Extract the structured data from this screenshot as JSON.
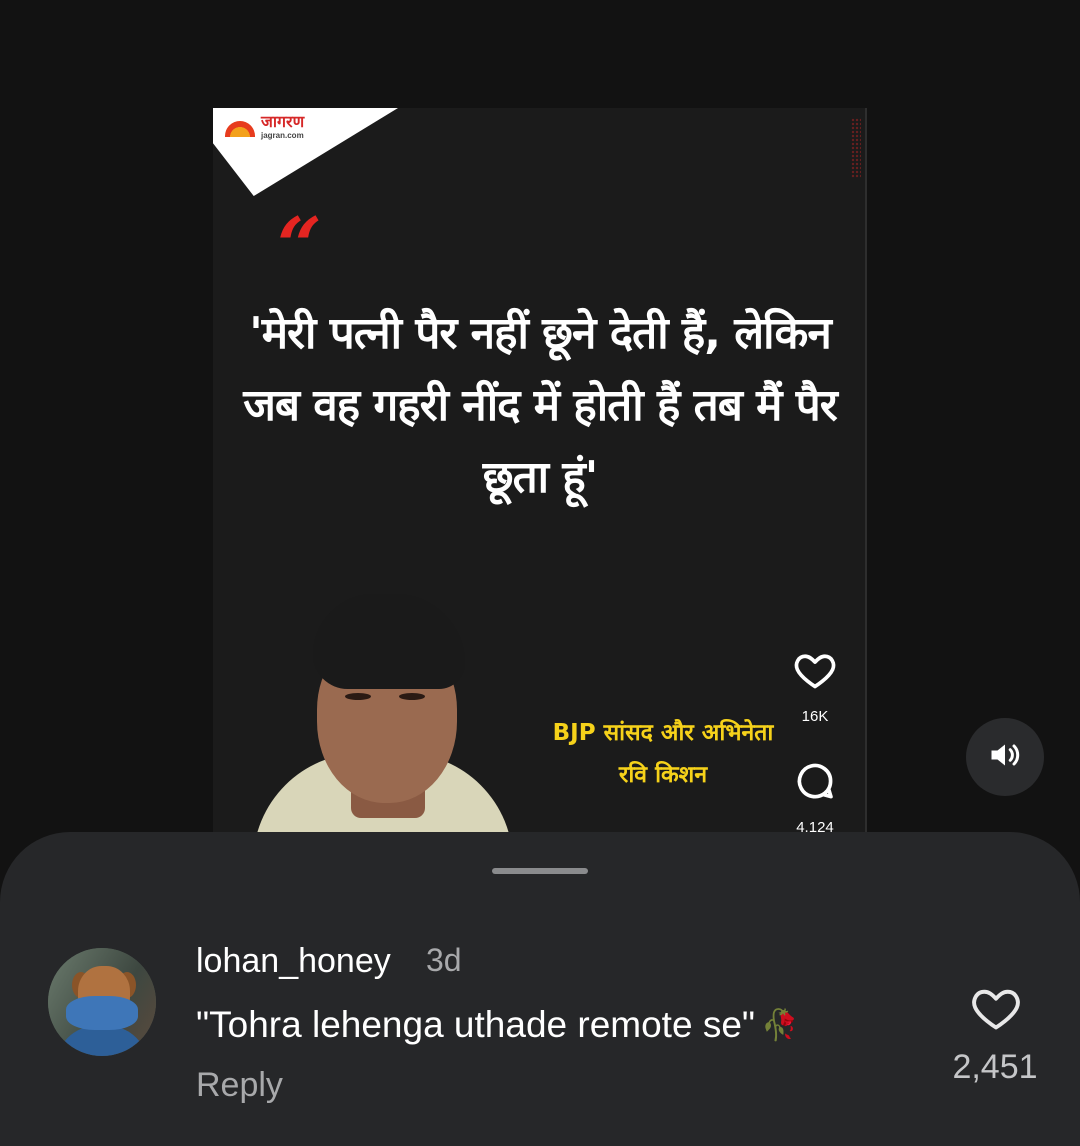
{
  "post": {
    "publisher_logo": "जागरण",
    "publisher_domain": "jagran.com",
    "quote_mark": "“",
    "quote_text": "'मेरी पत्नी पैर नहीं छूने देती हैं, लेकिन जब वह गहरी नींद में होती हैं तब मैं पैर छूता हूं'",
    "caption_line1": "BJP सांसद और अभिनेता",
    "caption_line2": "रवि किशन",
    "likes": "16K",
    "comments": "4,124"
  },
  "comment": {
    "username": "lohan_honey",
    "time": "3d",
    "text": "\"Tohra lehenga uthade remote se\"",
    "emoji": "🥀",
    "reply_label": "Reply",
    "likes": "2,451"
  },
  "icons": {
    "post_like": "heart-icon",
    "post_comment": "comment-bubble-icon",
    "sound": "speaker-icon",
    "comment_like": "heart-icon"
  },
  "colors": {
    "accent_red": "#e52521",
    "caption_yellow": "#f6d21a",
    "sheet_bg": "#262729"
  }
}
